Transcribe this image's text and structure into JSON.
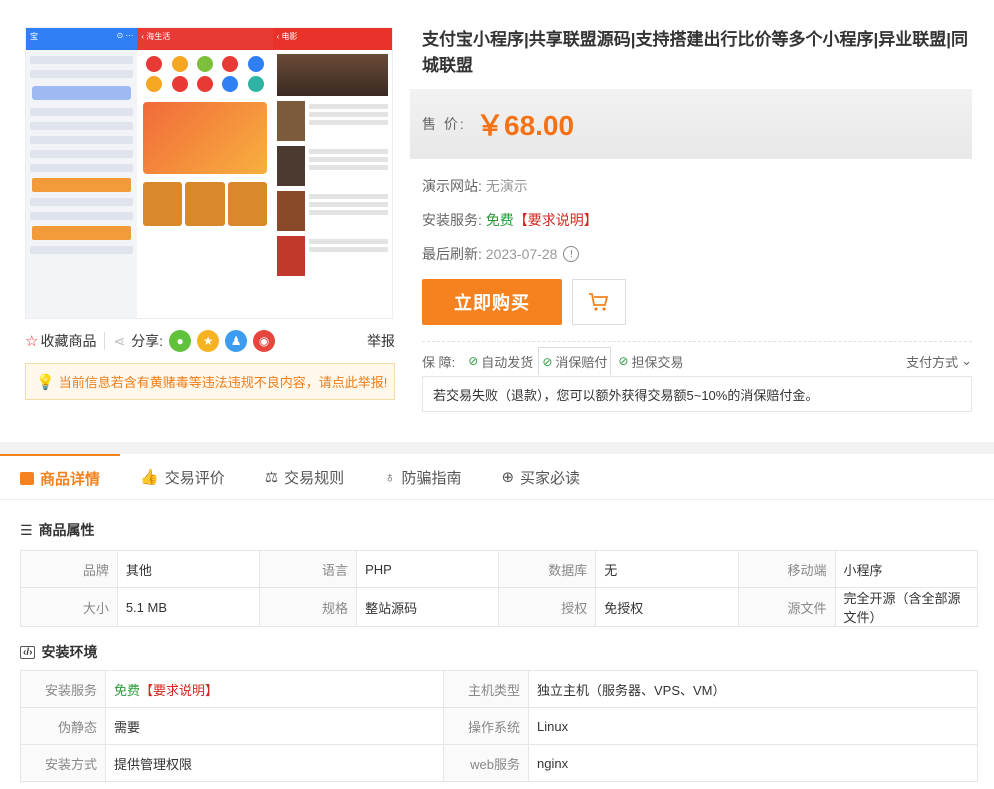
{
  "product": {
    "title": "支付宝小程序|共享联盟源码|支持搭建出行比价等多个小程序|异业联盟|同城联盟",
    "price_label": "售  价:",
    "price": "￥68.00"
  },
  "info_rows": {
    "demo_label": "演示网站:",
    "demo_value": "无演示",
    "install_label": "安装服务:",
    "install_value": "免费",
    "install_note": "【要求说明】",
    "refresh_label": "最后刷新:",
    "refresh_value": "2023-07-28"
  },
  "buttons": {
    "buy": "立即购买"
  },
  "guarantee": {
    "label": "保  障:",
    "items": [
      "自动发货",
      "消保赔付",
      "担保交易"
    ],
    "pay": "支付方式",
    "desc": "若交易失败（退款），您可以额外获得交易额5~10%的消保赔付金。"
  },
  "actions": {
    "favorite": "收藏商品",
    "share": "分享:",
    "report": "举报"
  },
  "notice": "当前信息若含有黄赌毒等违法违规不良内容，请点此举报!",
  "tabs": [
    "商品详情",
    "交易评价",
    "交易规则",
    "防骗指南",
    "买家必读"
  ],
  "attrs": {
    "title": "商品属性",
    "rows": [
      [
        [
          "品牌",
          "其他"
        ],
        [
          "语言",
          "PHP"
        ],
        [
          "数据库",
          "无"
        ],
        [
          "移动端",
          "小程序"
        ]
      ],
      [
        [
          "大小",
          "5.1 MB"
        ],
        [
          "规格",
          "整站源码"
        ],
        [
          "授权",
          "免授权"
        ],
        [
          "源文件",
          "完全开源（含全部源文件）"
        ]
      ]
    ]
  },
  "env": {
    "title": "安装环境",
    "rows": [
      [
        [
          "安装服务",
          "免费",
          "【要求说明】"
        ],
        [
          "主机类型",
          "独立主机（服务器、VPS、VM）"
        ]
      ],
      [
        [
          "伪静态",
          "需要"
        ],
        [
          "操作系统",
          "Linux"
        ]
      ],
      [
        [
          "安装方式",
          "提供管理权限"
        ],
        [
          "web服务",
          "nginx"
        ]
      ]
    ]
  },
  "colors": {
    "accent": "#f5821f",
    "price": "#f57214",
    "free": "#2a9a3a",
    "note": "#d2271e"
  }
}
